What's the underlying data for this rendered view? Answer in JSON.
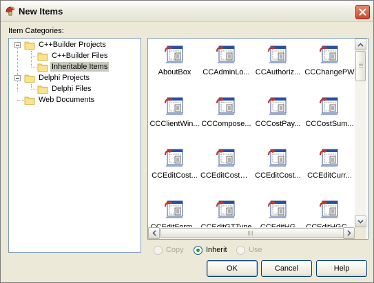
{
  "window": {
    "title": "New Items"
  },
  "categories": {
    "label": "Item Categories:",
    "tree": [
      {
        "label": "C++Builder Projects",
        "expanded": true,
        "selected": false
      },
      {
        "label": "C++Builder Files",
        "selected": false
      },
      {
        "label": "Inheritable Items",
        "selected": true
      },
      {
        "label": "Delphi Projects",
        "expanded": true,
        "selected": false
      },
      {
        "label": "Delphi Files",
        "selected": false
      },
      {
        "label": "Web Documents",
        "selected": false
      }
    ]
  },
  "items": [
    "AboutBox",
    "CCAdminLo...",
    "CCAuthoriz...",
    "CCChangePW",
    "CCClientWin...",
    "CCCompose...",
    "CCCostPay...",
    "CCCostSum...",
    "CCEditCost...",
    "CCEditCostGrp",
    "CCEditCost...",
    "CCEditCurr...",
    "CCEditForm...",
    "CCEditGTType",
    "CCEditHG",
    "CCEditHGC..."
  ],
  "options": {
    "copy": {
      "label": "Copy",
      "enabled": false,
      "checked": false
    },
    "inherit": {
      "label": "Inherit",
      "enabled": true,
      "checked": true
    },
    "use": {
      "label": "Use",
      "enabled": false,
      "checked": false
    }
  },
  "buttons": {
    "ok": "OK",
    "cancel": "Cancel",
    "help": "Help"
  },
  "colors": {
    "selection": "#c9c8be",
    "dialog_bg": "#ece9d8",
    "close_button": "#c94a2e"
  }
}
